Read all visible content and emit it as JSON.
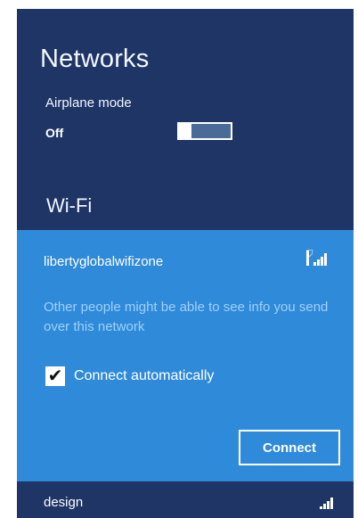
{
  "header": {
    "title": "Networks"
  },
  "airplane_mode": {
    "label": "Airplane mode",
    "state": "Off"
  },
  "wifi": {
    "section_title": "Wi-Fi",
    "selected_network": {
      "ssid": "libertyglobalwifizone",
      "signal_icon": "secured-wifi-signal-icon",
      "warning": "Other people might be able to see info you send over this network",
      "connect_automatically_label": "Connect automatically",
      "connect_automatically_checked": true,
      "connect_label": "Connect"
    },
    "networks": [
      {
        "ssid": "design",
        "signal_icon": "wifi-signal-icon"
      }
    ]
  },
  "colors": {
    "panel_bg": "#1f3566",
    "selected_bg": "#2f8ad9",
    "warning_text": "#9fd0f8",
    "toggle_off": "#4a6a98"
  }
}
